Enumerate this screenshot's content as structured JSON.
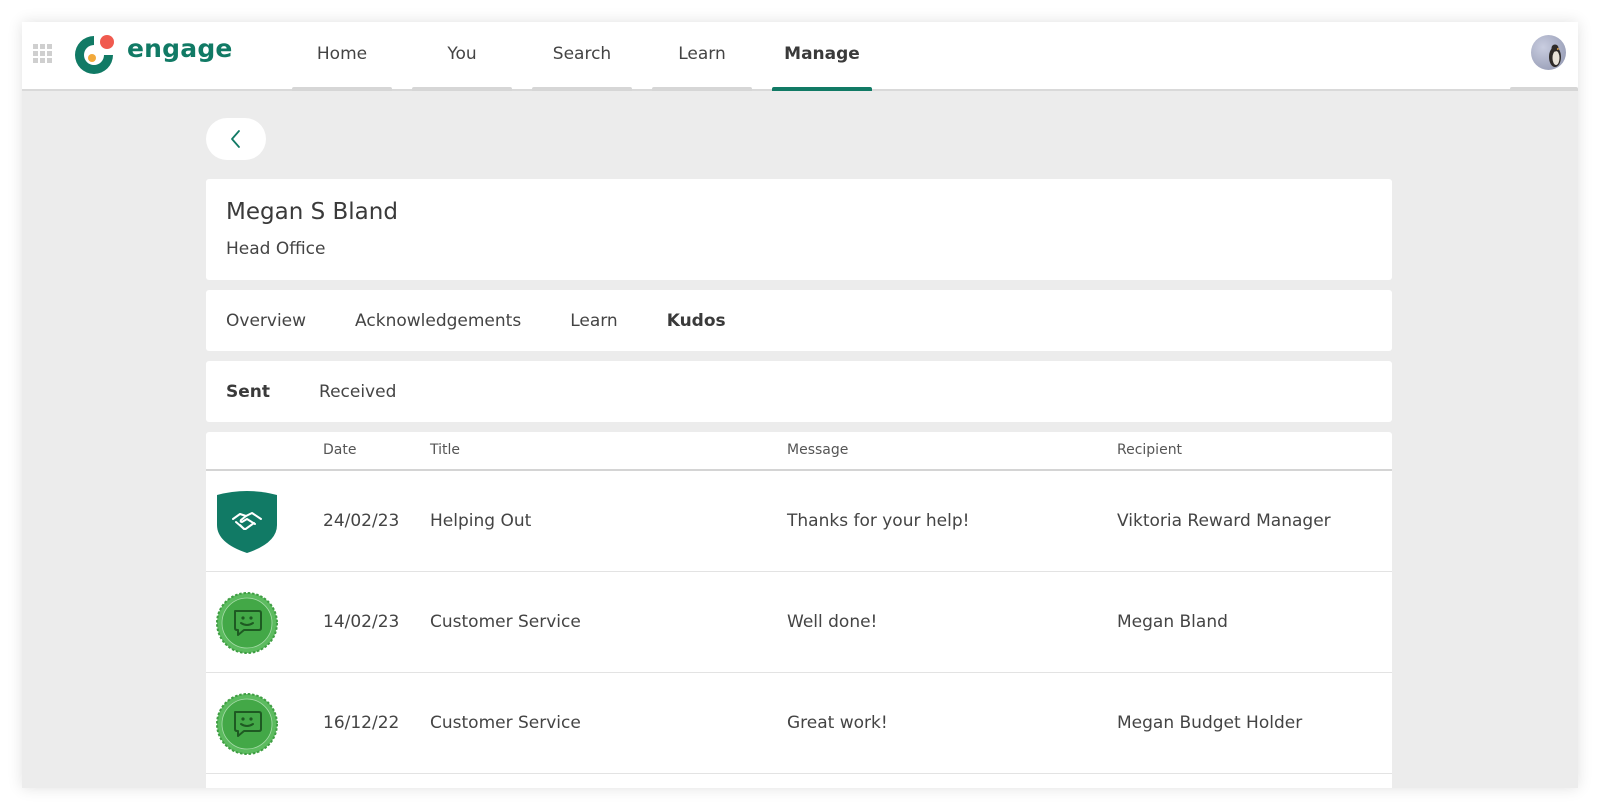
{
  "app": {
    "brand": "engage",
    "colors": {
      "accent": "#117a65",
      "logo_dot": "#f05a4f",
      "logo_orange": "#f2a93b",
      "kudos_green": "#4caf50"
    }
  },
  "nav": {
    "items": [
      {
        "label": "Home"
      },
      {
        "label": "You"
      },
      {
        "label": "Search"
      },
      {
        "label": "Learn"
      },
      {
        "label": "Manage"
      }
    ],
    "active": "Manage"
  },
  "profile": {
    "name": "Megan S Bland",
    "location": "Head Office"
  },
  "tabs": {
    "items": [
      {
        "label": "Overview"
      },
      {
        "label": "Acknowledgements"
      },
      {
        "label": "Learn"
      },
      {
        "label": "Kudos"
      }
    ],
    "active": "Kudos"
  },
  "subtabs": {
    "items": [
      {
        "label": "Sent"
      },
      {
        "label": "Received"
      }
    ],
    "active": "Sent"
  },
  "table": {
    "headers": {
      "date": "Date",
      "title": "Title",
      "message": "Message",
      "recipient": "Recipient"
    },
    "rows": [
      {
        "badge": "handshake-shield-icon",
        "date": "24/02/23",
        "title": "Helping Out",
        "message": "Thanks for your help!",
        "recipient": "Viktoria Reward Manager"
      },
      {
        "badge": "smiley-chat-rosette-icon",
        "date": "14/02/23",
        "title": "Customer Service",
        "message": "Well done!",
        "recipient": "Megan Bland"
      },
      {
        "badge": "smiley-chat-rosette-icon",
        "date": "16/12/22",
        "title": "Customer Service",
        "message": "Great work!",
        "recipient": "Megan Budget Holder"
      }
    ]
  }
}
